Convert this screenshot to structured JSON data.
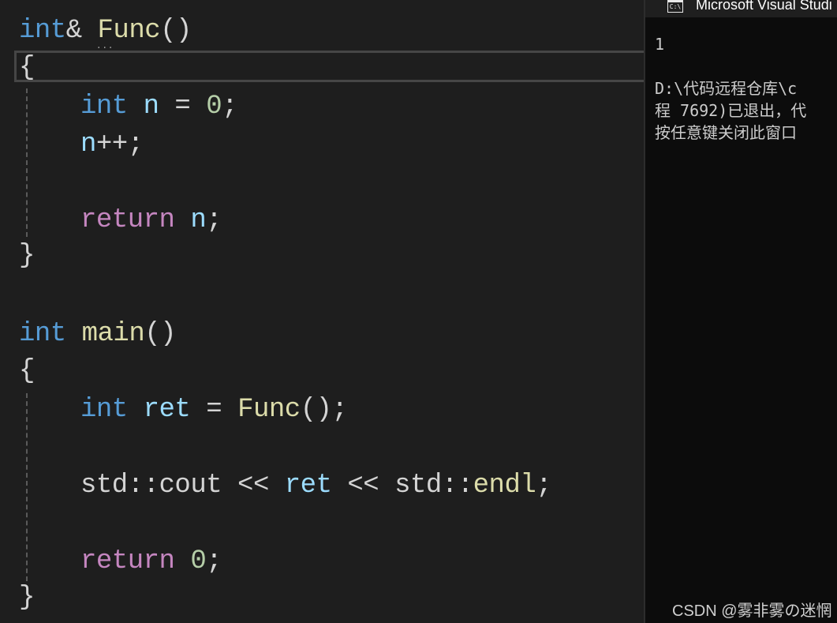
{
  "editor": {
    "lines": {
      "l1": {
        "t1": "int",
        "t2": "&",
        "t3": " Func",
        "t4": "()"
      },
      "l2": {
        "t1": "{"
      },
      "l3": {
        "t1": "int",
        "t2": " n",
        "t3": " = ",
        "t4": "0",
        "t5": ";"
      },
      "l4": {
        "t1": "n",
        "t2": "++;"
      },
      "l5": {
        "t1": "return",
        "t2": " n",
        "t3": ";"
      },
      "l6": {
        "t1": "}"
      },
      "l7": {
        "t1": "int",
        "t2": " main",
        "t3": "()"
      },
      "l8": {
        "t1": "{"
      },
      "l9": {
        "t1": "int",
        "t2": " ret",
        "t3": " = ",
        "t4": "Func",
        "t5": "();"
      },
      "l10": {
        "t1": "std::cout",
        "t2": " << ",
        "t3": "ret",
        "t4": " << ",
        "t5": "std::",
        "t6": "endl",
        "t7": ";"
      },
      "l11": {
        "t1": "return",
        "t2": " ",
        "t3": "0",
        "t4": ";"
      },
      "l12": {
        "t1": "}"
      }
    },
    "squiggle": "..."
  },
  "console": {
    "title": "Microsoft Visual Studi",
    "lines": [
      "1",
      "",
      "D:\\代码远程仓库\\c",
      "程 7692)已退出，代",
      "按任意键关闭此窗口"
    ]
  },
  "watermark": "CSDN @雾非雾の迷惘",
  "colors": {
    "editor_bg": "#1e1e1e",
    "keyword": "#569cd6",
    "control": "#c586c0",
    "function": "#dcdcaa",
    "variable": "#9cdcfe",
    "number": "#b5cea8",
    "console_bg": "#0c0c0c"
  }
}
